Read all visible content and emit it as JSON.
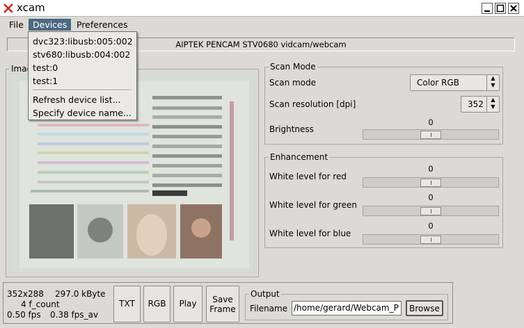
{
  "window": {
    "title": "xcam"
  },
  "menubar": {
    "file": "File",
    "devices": "Devices",
    "preferences": "Preferences"
  },
  "devices_menu": {
    "items": [
      "dvc323:libusb:005:002",
      "stv680:libusb:004:002",
      "test:0",
      "test:1"
    ],
    "refresh": "Refresh device list...",
    "specify": "Specify device name..."
  },
  "device_banner": "AIPTEK PENCAM STV0680 vidcam/webcam",
  "image_frame": {
    "label": "Imag"
  },
  "scan_mode": {
    "title": "Scan Mode",
    "mode_label": "Scan mode",
    "mode_value": "Color RGB",
    "resolution_label": "Scan resolution [dpi]",
    "resolution_value": "352",
    "brightness_label": "Brightness",
    "brightness_value": "0",
    "brightness_level": 0.5
  },
  "enhancement": {
    "title": "Enhancement",
    "red_label": "White level for red",
    "red_value": "0",
    "green_label": "White level for green",
    "green_value": "0",
    "blue_label": "White level for blue",
    "blue_value": "0",
    "level": 0.5
  },
  "status": {
    "resolution": "352x288",
    "size": "297.0 kByte",
    "frames": "4 f_count",
    "fps": "0.50 fps",
    "fps_av": "0.38 fps_av"
  },
  "buttons": {
    "txt": "TXT",
    "rgb": "RGB",
    "play": "Play",
    "save_line1": "Save",
    "save_line2": "Frame"
  },
  "output": {
    "title": "Output",
    "filename_label": "Filename",
    "filename_value": "/home/gerard/Webcam_P",
    "browse": "Browse"
  },
  "colors": {
    "menu_highlight": "#4b6983",
    "window_bg": "#dcdad5",
    "close_x": "#d22222"
  }
}
